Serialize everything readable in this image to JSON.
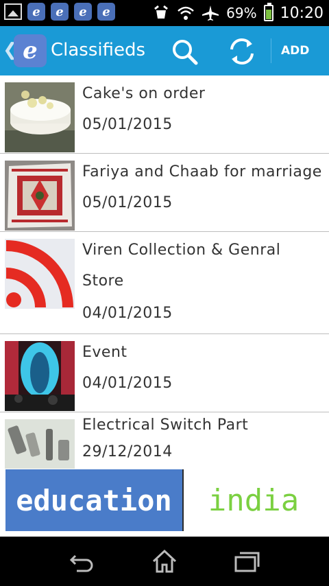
{
  "status_bar": {
    "battery": "69%",
    "time": "10:20",
    "notification_icons": [
      "image-icon",
      "e-app-icon",
      "e-app-icon",
      "e-app-icon",
      "e-app-icon"
    ]
  },
  "app_bar": {
    "title": "Classifieds",
    "logo_letter": "e",
    "add_label": "ADD",
    "color": "#1a9ad6"
  },
  "items": [
    {
      "title": "Cake's on order",
      "date": "05/01/2015"
    },
    {
      "title": "Fariya and Chaab for marriage",
      "date": "05/01/2015"
    },
    {
      "title": "Viren Collection & Genral Store",
      "date": "04/01/2015"
    },
    {
      "title": "Event",
      "date": "04/01/2015"
    },
    {
      "title": "Electrical Switch Part",
      "date": "29/12/2014"
    }
  ],
  "banner": {
    "left_text": "education",
    "right_text": "india"
  }
}
